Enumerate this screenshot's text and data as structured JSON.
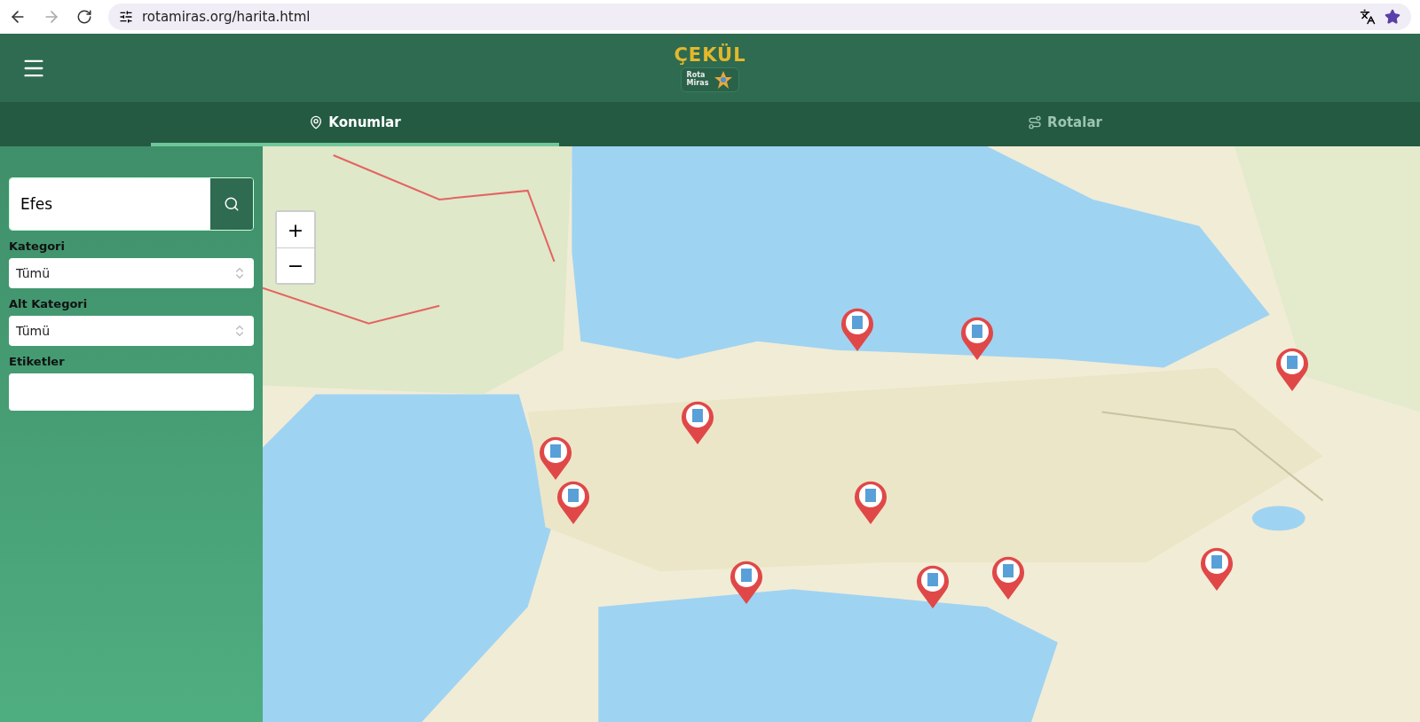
{
  "browser": {
    "url": "rotamiras.org/harita.html"
  },
  "header": {
    "logo_top": "ÇEKÜL",
    "logo_bottom": [
      "Rota",
      "Miras"
    ]
  },
  "tabs": [
    {
      "label": "Konumlar",
      "selected": true,
      "kind": "pin"
    },
    {
      "label": "Rotalar",
      "selected": false,
      "kind": "route"
    }
  ],
  "sidebar": {
    "search": {
      "value": "Efes"
    },
    "filters": [
      {
        "label": "Kategori",
        "kind": "select",
        "value": "Tümü"
      },
      {
        "label": "Alt Kategori",
        "kind": "select",
        "value": "Tümü"
      },
      {
        "label": "Etiketler",
        "kind": "text"
      }
    ]
  },
  "map": {
    "zoom_in": "+",
    "zoom_out": "−"
  }
}
